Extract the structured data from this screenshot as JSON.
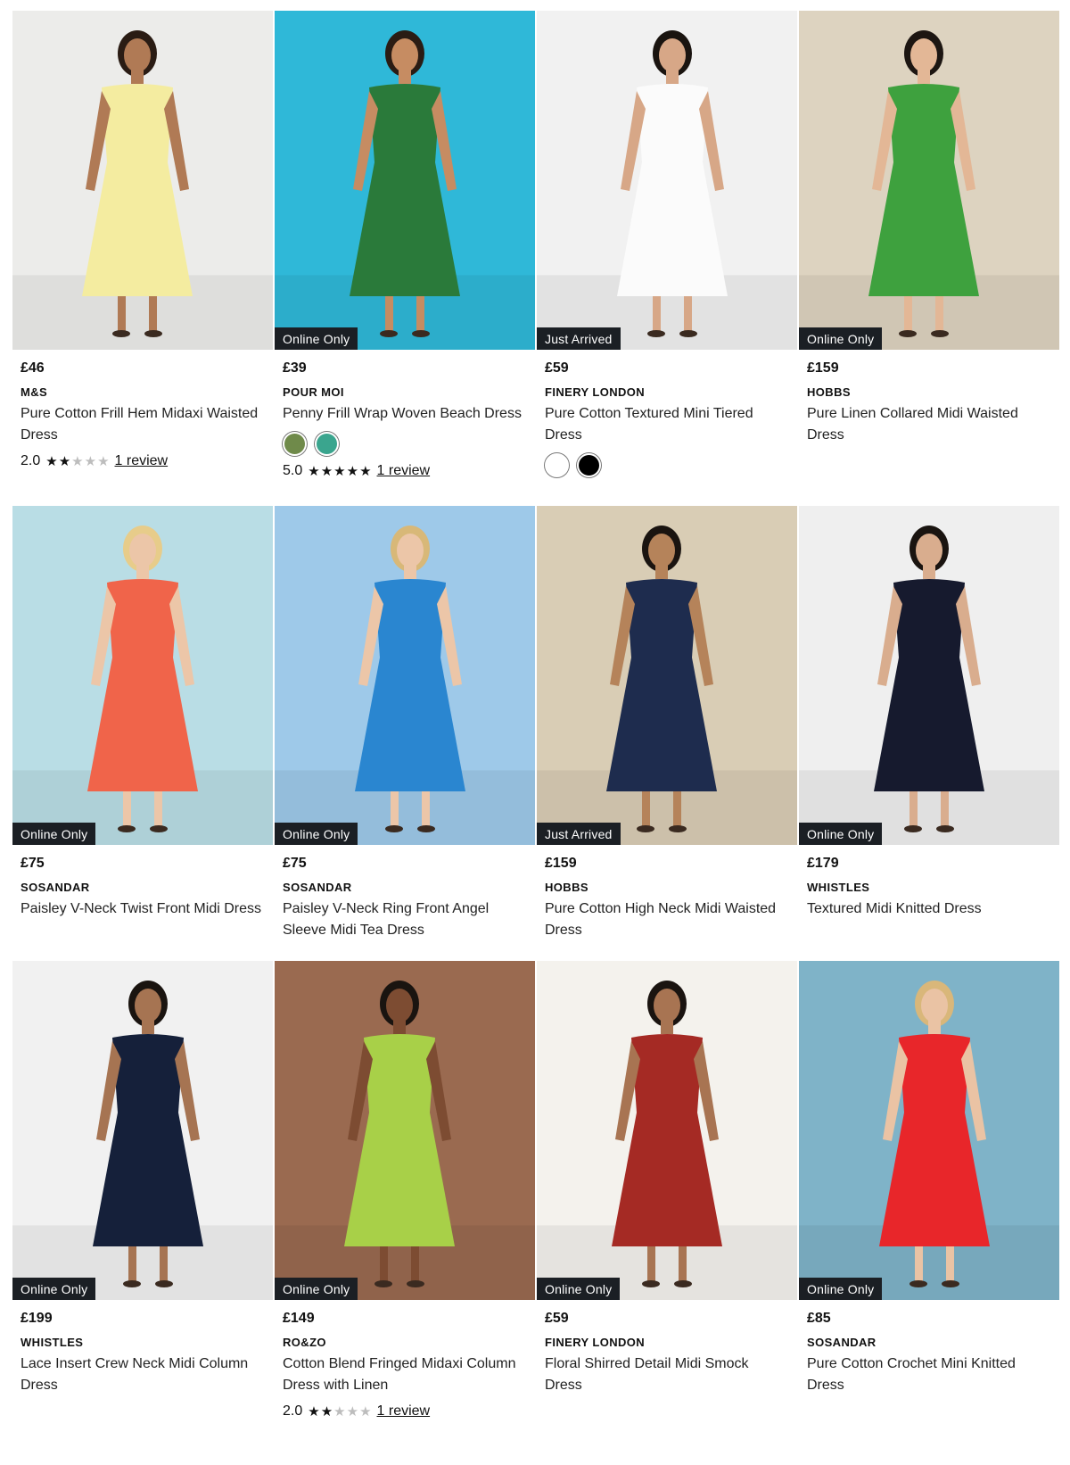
{
  "products": [
    {
      "badge": "",
      "price": "£46",
      "brand": "M&S",
      "name": "Pure Cotton Frill Hem Midaxi Waisted Dress",
      "rating": "2.0",
      "stars": 2,
      "reviews": "1 review",
      "swatches": [],
      "bg": "#ececea",
      "dress": "#f4eca0",
      "skin": "#b07a55",
      "hair": "#2a1c14"
    },
    {
      "badge": "Online Only",
      "price": "£39",
      "brand": "POUR MOI",
      "name": "Penny Frill Wrap Woven Beach Dress",
      "rating": "5.0",
      "stars": 5,
      "reviews": "1 review",
      "swatches": [
        "#6f8a4a",
        "#3aa58e"
      ],
      "bg": "#2fb8d8",
      "dress": "#2a7a3a",
      "skin": "#c68c62",
      "hair": "#2a1c14"
    },
    {
      "badge": "Just Arrived",
      "price": "£59",
      "brand": "FINERY LONDON",
      "name": "Pure Cotton Textured Mini Tiered Dress",
      "rating": "",
      "stars": 0,
      "reviews": "",
      "swatches": [
        "#ffffff",
        "#000000"
      ],
      "bg": "#f1f1f1",
      "dress": "#fbfbfb",
      "skin": "#d7a787",
      "hair": "#1a1410"
    },
    {
      "badge": "Online Only",
      "price": "£159",
      "brand": "HOBBS",
      "name": "Pure Linen Collared Midi Waisted Dress",
      "rating": "",
      "stars": 0,
      "reviews": "",
      "swatches": [],
      "bg": "#ddd3c0",
      "dress": "#3ea13e",
      "skin": "#e3b796",
      "hair": "#1d1612"
    },
    {
      "badge": "Online Only",
      "price": "£75",
      "brand": "SOSANDAR",
      "name": "Paisley V-Neck Twist Front Midi Dress",
      "rating": "",
      "stars": 0,
      "reviews": "",
      "swatches": [],
      "bg": "#b9dde5",
      "dress": "#f0644a",
      "skin": "#ecc6a8",
      "hair": "#e7cc8a"
    },
    {
      "badge": "Online Only",
      "price": "£75",
      "brand": "SOSANDAR",
      "name": "Paisley V-Neck Ring Front Angel Sleeve Midi Tea Dress",
      "rating": "",
      "stars": 0,
      "reviews": "",
      "swatches": [],
      "bg": "#9ec9e9",
      "dress": "#2a86d0",
      "skin": "#ecc6a8",
      "hair": "#d8b878"
    },
    {
      "badge": "Just Arrived",
      "price": "£159",
      "brand": "HOBBS",
      "name": "Pure Cotton High Neck Midi Waisted Dress",
      "rating": "",
      "stars": 0,
      "reviews": "",
      "swatches": [],
      "bg": "#d9cdb5",
      "dress": "#1e2c4e",
      "skin": "#b5835a",
      "hair": "#1a1410"
    },
    {
      "badge": "Online Only",
      "price": "£179",
      "brand": "WHISTLES",
      "name": "Textured Midi Knitted Dress",
      "rating": "",
      "stars": 0,
      "reviews": "",
      "swatches": [],
      "bg": "#efefef",
      "dress": "#161a2e",
      "skin": "#d9ad8e",
      "hair": "#1a1410"
    },
    {
      "badge": "Online Only",
      "price": "£199",
      "brand": "WHISTLES",
      "name": "Lace Insert Crew Neck Midi Column Dress",
      "rating": "",
      "stars": 0,
      "reviews": "",
      "swatches": [],
      "bg": "#f1f1f1",
      "dress": "#15203a",
      "skin": "#a67452",
      "hair": "#1a1410"
    },
    {
      "badge": "Online Only",
      "price": "£149",
      "brand": "RO&ZO",
      "name": "Cotton Blend Fringed Midaxi Column Dress with Linen",
      "rating": "2.0",
      "stars": 2,
      "reviews": "1 review",
      "swatches": [],
      "bg": "#9a6a50",
      "dress": "#a8d048",
      "skin": "#7d4c32",
      "hair": "#1a1410"
    },
    {
      "badge": "Online Only",
      "price": "£59",
      "brand": "FINERY LONDON",
      "name": "Floral Shirred Detail Midi Smock Dress",
      "rating": "",
      "stars": 0,
      "reviews": "",
      "swatches": [],
      "bg": "#f4f2ed",
      "dress": "#a52a24",
      "skin": "#a87452",
      "hair": "#1a1410"
    },
    {
      "badge": "Online Only",
      "price": "£85",
      "brand": "SOSANDAR",
      "name": "Pure Cotton Crochet Mini Knitted Dress",
      "rating": "",
      "stars": 0,
      "reviews": "",
      "swatches": [],
      "bg": "#7fb3c8",
      "dress": "#e8262a",
      "skin": "#eac3a4",
      "hair": "#d9b77a"
    }
  ]
}
